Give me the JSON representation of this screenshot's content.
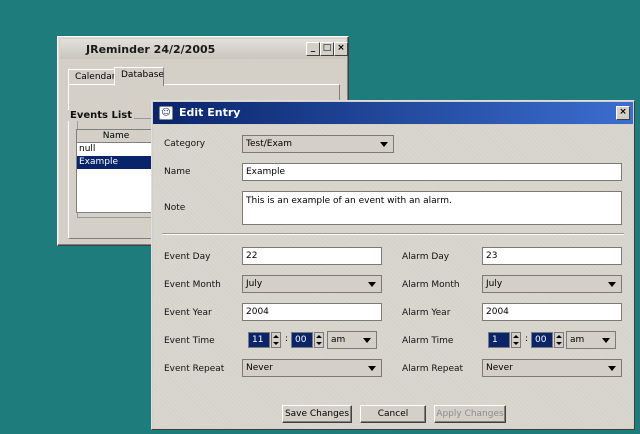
{
  "back_window": {
    "title": "JReminder 24/2/2005",
    "tabs": [
      "Calendar",
      "Database"
    ],
    "events_list_label": "Events List",
    "list_header": "Name",
    "list_items": [
      "null",
      "Example"
    ],
    "selected_index": 1
  },
  "dialog": {
    "title": "Edit Entry",
    "category": {
      "label": "Category",
      "value": "Test/Exam"
    },
    "name": {
      "label": "Name",
      "value": "Example"
    },
    "note": {
      "label": "Note",
      "value": "This is an example of an event with an alarm."
    },
    "event": {
      "day_label": "Event Day",
      "day": "22",
      "month_label": "Event Month",
      "month": "July",
      "year_label": "Event Year",
      "year": "2004",
      "time_label": "Event Time",
      "hour": "11",
      "minute": "00",
      "ampm": "am",
      "repeat_label": "Event Repeat",
      "repeat": "Never"
    },
    "alarm": {
      "day_label": "Alarm Day",
      "day": "23",
      "month_label": "Alarm Month",
      "month": "July",
      "year_label": "Alarm Year",
      "year": "2004",
      "time_label": "Alarm Time",
      "hour": "1",
      "minute": "00",
      "ampm": "am",
      "repeat_label": "Alarm Repeat",
      "repeat": "Never"
    },
    "buttons": {
      "save": "Save Changes",
      "cancel": "Cancel",
      "apply": "Apply Changes"
    }
  },
  "colors": {
    "desktop": "#1e7c7c",
    "title_active": "#0a246a",
    "selection": "#0a246a"
  }
}
